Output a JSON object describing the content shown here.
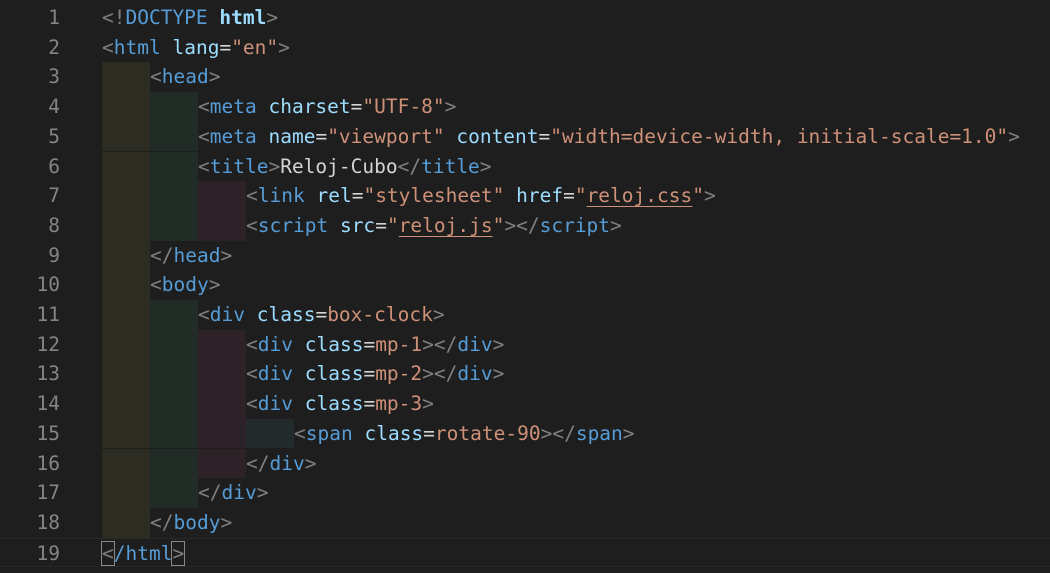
{
  "editor": {
    "lines": [
      {
        "num": "1",
        "indent": 0,
        "tokens": [
          {
            "t": "<!",
            "c": "punct"
          },
          {
            "t": "DOCTYPE",
            "c": "doctype"
          },
          {
            "t": " ",
            "c": "plain"
          },
          {
            "t": "html",
            "c": "attr bold"
          },
          {
            "t": ">",
            "c": "punct"
          }
        ]
      },
      {
        "num": "2",
        "indent": 0,
        "tokens": [
          {
            "t": "<",
            "c": "punct"
          },
          {
            "t": "html",
            "c": "tag"
          },
          {
            "t": " ",
            "c": "plain"
          },
          {
            "t": "lang",
            "c": "attr"
          },
          {
            "t": "=",
            "c": "plain"
          },
          {
            "t": "\"en\"",
            "c": "str"
          },
          {
            "t": ">",
            "c": "punct"
          }
        ]
      },
      {
        "num": "3",
        "indent": 1,
        "tokens": [
          {
            "t": "<",
            "c": "punct"
          },
          {
            "t": "head",
            "c": "tag"
          },
          {
            "t": ">",
            "c": "punct"
          }
        ]
      },
      {
        "num": "4",
        "indent": 2,
        "tokens": [
          {
            "t": "<",
            "c": "punct"
          },
          {
            "t": "meta",
            "c": "tag"
          },
          {
            "t": " ",
            "c": "plain"
          },
          {
            "t": "charset",
            "c": "attr"
          },
          {
            "t": "=",
            "c": "plain"
          },
          {
            "t": "\"UTF-8\"",
            "c": "str"
          },
          {
            "t": ">",
            "c": "punct"
          }
        ]
      },
      {
        "num": "5",
        "indent": 2,
        "tokens": [
          {
            "t": "<",
            "c": "punct"
          },
          {
            "t": "meta",
            "c": "tag"
          },
          {
            "t": " ",
            "c": "plain"
          },
          {
            "t": "name",
            "c": "attr"
          },
          {
            "t": "=",
            "c": "plain"
          },
          {
            "t": "\"viewport\"",
            "c": "str"
          },
          {
            "t": " ",
            "c": "plain"
          },
          {
            "t": "content",
            "c": "attr"
          },
          {
            "t": "=",
            "c": "plain"
          },
          {
            "t": "\"width=device-width, initial-scale=1.0\"",
            "c": "str"
          },
          {
            "t": ">",
            "c": "punct"
          }
        ]
      },
      {
        "num": "6",
        "indent": 2,
        "tokens": [
          {
            "t": "<",
            "c": "punct"
          },
          {
            "t": "title",
            "c": "tag"
          },
          {
            "t": ">",
            "c": "punct"
          },
          {
            "t": "Reloj-Cubo",
            "c": "plain"
          },
          {
            "t": "</",
            "c": "punct"
          },
          {
            "t": "title",
            "c": "tag"
          },
          {
            "t": ">",
            "c": "punct"
          }
        ]
      },
      {
        "num": "7",
        "indent": 3,
        "tokens": [
          {
            "t": "<",
            "c": "punct"
          },
          {
            "t": "link",
            "c": "tag"
          },
          {
            "t": " ",
            "c": "plain"
          },
          {
            "t": "rel",
            "c": "attr"
          },
          {
            "t": "=",
            "c": "plain"
          },
          {
            "t": "\"stylesheet\"",
            "c": "str"
          },
          {
            "t": " ",
            "c": "plain"
          },
          {
            "t": "href",
            "c": "attr"
          },
          {
            "t": "=",
            "c": "plain"
          },
          {
            "t": "\"",
            "c": "str"
          },
          {
            "t": "reloj.css",
            "c": "str squiggle"
          },
          {
            "t": "\"",
            "c": "str"
          },
          {
            "t": ">",
            "c": "punct"
          }
        ]
      },
      {
        "num": "8",
        "indent": 3,
        "tokens": [
          {
            "t": "<",
            "c": "punct"
          },
          {
            "t": "script",
            "c": "tag"
          },
          {
            "t": " ",
            "c": "plain"
          },
          {
            "t": "src",
            "c": "attr"
          },
          {
            "t": "=",
            "c": "plain"
          },
          {
            "t": "\"",
            "c": "str"
          },
          {
            "t": "reloj.js",
            "c": "str squiggle"
          },
          {
            "t": "\"",
            "c": "str"
          },
          {
            "t": ">",
            "c": "punct"
          },
          {
            "t": "</",
            "c": "punct"
          },
          {
            "t": "script",
            "c": "tag"
          },
          {
            "t": ">",
            "c": "punct"
          }
        ]
      },
      {
        "num": "9",
        "indent": 1,
        "tokens": [
          {
            "t": "</",
            "c": "punct"
          },
          {
            "t": "head",
            "c": "tag"
          },
          {
            "t": ">",
            "c": "punct"
          }
        ]
      },
      {
        "num": "10",
        "indent": 1,
        "tokens": [
          {
            "t": "<",
            "c": "punct"
          },
          {
            "t": "body",
            "c": "tag"
          },
          {
            "t": ">",
            "c": "punct"
          }
        ]
      },
      {
        "num": "11",
        "indent": 2,
        "tokens": [
          {
            "t": "<",
            "c": "punct"
          },
          {
            "t": "div",
            "c": "tag"
          },
          {
            "t": " ",
            "c": "plain"
          },
          {
            "t": "class",
            "c": "attr"
          },
          {
            "t": "=",
            "c": "plain"
          },
          {
            "t": "box-clock",
            "c": "str"
          },
          {
            "t": ">",
            "c": "punct"
          }
        ]
      },
      {
        "num": "12",
        "indent": 3,
        "tokens": [
          {
            "t": "<",
            "c": "punct"
          },
          {
            "t": "div",
            "c": "tag"
          },
          {
            "t": " ",
            "c": "plain"
          },
          {
            "t": "class",
            "c": "attr"
          },
          {
            "t": "=",
            "c": "plain"
          },
          {
            "t": "mp-1",
            "c": "str"
          },
          {
            "t": ">",
            "c": "punct"
          },
          {
            "t": "</",
            "c": "punct"
          },
          {
            "t": "div",
            "c": "tag"
          },
          {
            "t": ">",
            "c": "punct"
          }
        ]
      },
      {
        "num": "13",
        "indent": 3,
        "tokens": [
          {
            "t": "<",
            "c": "punct"
          },
          {
            "t": "div",
            "c": "tag"
          },
          {
            "t": " ",
            "c": "plain"
          },
          {
            "t": "class",
            "c": "attr"
          },
          {
            "t": "=",
            "c": "plain"
          },
          {
            "t": "mp-2",
            "c": "str"
          },
          {
            "t": ">",
            "c": "punct"
          },
          {
            "t": "</",
            "c": "punct"
          },
          {
            "t": "div",
            "c": "tag"
          },
          {
            "t": ">",
            "c": "punct"
          }
        ]
      },
      {
        "num": "14",
        "indent": 3,
        "tokens": [
          {
            "t": "<",
            "c": "punct"
          },
          {
            "t": "div",
            "c": "tag"
          },
          {
            "t": " ",
            "c": "plain"
          },
          {
            "t": "class",
            "c": "attr"
          },
          {
            "t": "=",
            "c": "plain"
          },
          {
            "t": "mp-3",
            "c": "str"
          },
          {
            "t": ">",
            "c": "punct"
          }
        ]
      },
      {
        "num": "15",
        "indent": 4,
        "tokens": [
          {
            "t": "<",
            "c": "punct"
          },
          {
            "t": "span",
            "c": "tag"
          },
          {
            "t": " ",
            "c": "plain"
          },
          {
            "t": "class",
            "c": "attr"
          },
          {
            "t": "=",
            "c": "plain"
          },
          {
            "t": "rotate-90",
            "c": "str"
          },
          {
            "t": ">",
            "c": "punct"
          },
          {
            "t": "</",
            "c": "punct"
          },
          {
            "t": "span",
            "c": "tag"
          },
          {
            "t": ">",
            "c": "punct"
          }
        ]
      },
      {
        "num": "16",
        "indent": 3,
        "tokens": [
          {
            "t": "</",
            "c": "punct"
          },
          {
            "t": "div",
            "c": "tag"
          },
          {
            "t": ">",
            "c": "punct"
          }
        ]
      },
      {
        "num": "17",
        "indent": 2,
        "tokens": [
          {
            "t": "</",
            "c": "punct"
          },
          {
            "t": "div",
            "c": "tag"
          },
          {
            "t": ">",
            "c": "punct"
          }
        ]
      },
      {
        "num": "18",
        "indent": 1,
        "tokens": [
          {
            "t": "</",
            "c": "punct"
          },
          {
            "t": "body",
            "c": "tag"
          },
          {
            "t": ">",
            "c": "punct"
          }
        ]
      },
      {
        "num": "19",
        "indent": 0,
        "tokens": [
          {
            "t": "<",
            "c": "punct bracket-match"
          },
          {
            "t": "/html",
            "c": "tag"
          },
          {
            "t": ">",
            "c": "punct bracket-match"
          }
        ]
      }
    ]
  },
  "colors": {
    "background": "#1e1e1e",
    "line_number": "#858585",
    "tag": "#569cd6",
    "attribute": "#9cdcfe",
    "string": "#ce9178",
    "punctuation": "#808080",
    "text": "#d4d4d4"
  }
}
